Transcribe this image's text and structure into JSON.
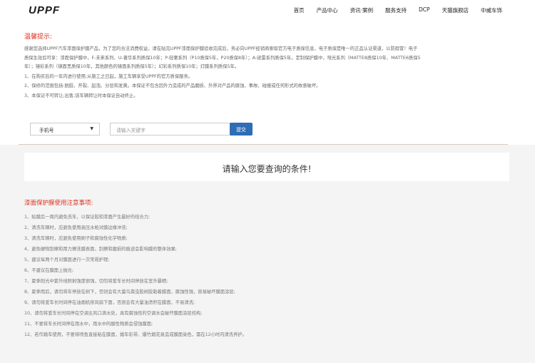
{
  "nav": {
    "logo": "UPPF",
    "items": [
      "首页",
      "产品中心",
      "资讯·案例",
      "服务支持",
      "DCP",
      "天猫旗舰店",
      "中威车饰"
    ]
  },
  "notice": {
    "title": "温馨提示:",
    "paragraph": [
      "感谢您选择UPPF汽车漆面保护膜产品，为了您的合法消费权益，请在贴完UPPF漆面保护膜验收完成后，务必向UPPF经销商索取官方电子质保信息，电子质保是唯一的正品认证渠道，以防假冒！电子",
      "质保生效后可享：漆面保护膜中，F-未来系列、U-著华系列质保10年；P-轻奢系列（P10质保5年，P20质保8年）；A-锐雷系列质保5年。定制保护膜中，哑光系列（MATTE8质保10年、MATTE6质保5",
      "年）；镜彩系列（镜面黑质保10年，其他颜色的镜面系列质保5年）；幻彩系列质保10年；灯膜系列质保5年。"
    ],
    "rules": [
      "1、在购买后的一年内进行使用;从施工之日起，施工车辆享受UPPF的官方质保服务。",
      "2、保修的范围包括:脱胶、开裂、起泡、分层和发黄。本保证不包含因外力造成的产品磨损、外界对产品的腐蚀、事故、碰撞或任何形式的故意破坏。",
      "3、本保证不可转让;出售;该车辆转让时本保证自动终止。"
    ]
  },
  "form": {
    "select_value": "手机号",
    "select_arrow": "▼",
    "input_placeholder": "请输入关键字",
    "submit_label": "提交"
  },
  "result": {
    "message": "请输入您要查询的条件!"
  },
  "care": {
    "title": "漆面保护膜使用注意事项:",
    "items": [
      "1、贴膜后一周内避免洗车，以保证胶和漆面产生最好的结合力;",
      "2、清洗车辆时，应避免使用高压水枪对膜边缘冲洗;",
      "3、清洗车辆时，应避免使用刷子和腐蚀性化学物质;",
      "4、避免硬物刮擦和用力擦洗膜表面，刮擦和磨损的痕迹会影响膜的整体效果;",
      "5、建议每两个月对膜面进行一次常规护理;",
      "6、不建议在膜面上抛光;",
      "7、夏季阳光中紫外线照射强度很强，切勿将爱车长时间停放在室外暴晒;",
      "8、夏季雨后，请勿将车停放在树下，否则会有大量鸟粪虫胶树胶黏着膜面，腐蚀性强，容易破坏膜面涂层;",
      "9、请勿将爱车长时间停在油烟机排风扇下面，否则会有大量油渍积在膜面，不易清洗;",
      "10、请勿将爱车长时间停在空调主风口滴水处，具有腐蚀性的空调水会破坏膜面涂层结构;",
      "11、不要将车长时间停在雨水中，雨水中的酸性物质会侵蚀膜面;",
      "12、若作婚车使用，不要将喷鱼直接粘在膜面，婚车彩带、爆竹烟花易造成膜面染色，需在12小时内清洗养护。"
    ]
  }
}
